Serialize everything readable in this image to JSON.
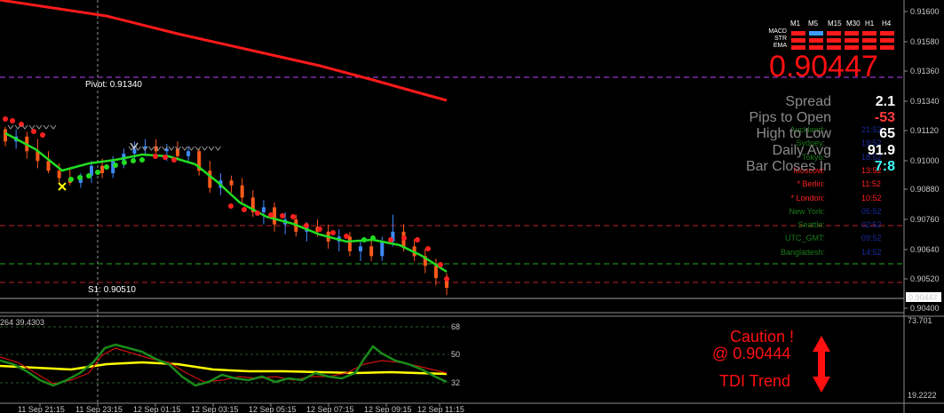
{
  "chart_data": [
    {
      "type": "candlestick",
      "title": "",
      "y_axis_ticks": [
        "0.91600",
        "0.91580",
        "0.91360",
        "0.91340",
        "0.91120",
        "0.91000",
        "0.90880",
        "0.90760",
        "0.90640",
        "0.90520",
        "0.90400"
      ],
      "current_price_tag": "0.90447",
      "x_axis_ticks": [
        "11 Sep 21:15",
        "11 Sep 23:15",
        "12 Sep 01:15",
        "12 Sep 03:15",
        "12 Sep 05:15",
        "12 Sep 07:15",
        "12 Sep 09:15",
        "12 Sep 11:15"
      ],
      "pivot_label": "Pivot: 0.91340",
      "s1_label": "S1: 0.90510",
      "ylim": [
        0.9039,
        0.9165
      ],
      "candles": [
        [
          0.9112,
          0.9113,
          0.9105,
          0.9107
        ],
        [
          0.9107,
          0.9112,
          0.9104,
          0.9109
        ],
        [
          0.9109,
          0.9111,
          0.91,
          0.9103
        ],
        [
          0.9103,
          0.9108,
          0.9096,
          0.9099
        ],
        [
          0.9099,
          0.9103,
          0.9094,
          0.9095
        ],
        [
          0.9095,
          0.9098,
          0.909,
          0.9092
        ],
        [
          0.9092,
          0.9096,
          0.9089,
          0.909
        ],
        [
          0.909,
          0.9094,
          0.9088,
          0.9093
        ],
        [
          0.9093,
          0.9099,
          0.909,
          0.9097
        ],
        [
          0.9097,
          0.91,
          0.9092,
          0.9094
        ],
        [
          0.9094,
          0.9101,
          0.9092,
          0.9099
        ],
        [
          0.9099,
          0.9104,
          0.9096,
          0.9102
        ],
        [
          0.9102,
          0.9107,
          0.91,
          0.9104
        ],
        [
          0.9104,
          0.9108,
          0.9101,
          0.9105
        ],
        [
          0.9105,
          0.9108,
          0.91,
          0.9103
        ],
        [
          0.9103,
          0.9106,
          0.9099,
          0.9104
        ],
        [
          0.9104,
          0.9107,
          0.91,
          0.9101
        ],
        [
          0.9101,
          0.9105,
          0.9099,
          0.9103
        ],
        [
          0.9103,
          0.9104,
          0.9093,
          0.9095
        ],
        [
          0.9095,
          0.9099,
          0.9086,
          0.9088
        ],
        [
          0.9088,
          0.9094,
          0.9085,
          0.9091
        ],
        [
          0.9091,
          0.9093,
          0.9086,
          0.9089
        ],
        [
          0.9089,
          0.9092,
          0.9082,
          0.9084
        ],
        [
          0.9084,
          0.9087,
          0.9076,
          0.9078
        ],
        [
          0.9078,
          0.9083,
          0.9073,
          0.908
        ],
        [
          0.908,
          0.9082,
          0.907,
          0.9073
        ],
        [
          0.9073,
          0.9078,
          0.9069,
          0.9075
        ],
        [
          0.9075,
          0.9077,
          0.9068,
          0.907
        ],
        [
          0.907,
          0.9074,
          0.9066,
          0.9072
        ],
        [
          0.9072,
          0.9075,
          0.9068,
          0.907
        ],
        [
          0.907,
          0.9073,
          0.9063,
          0.9066
        ],
        [
          0.9066,
          0.9071,
          0.9062,
          0.9068
        ],
        [
          0.9068,
          0.907,
          0.906,
          0.9062
        ],
        [
          0.9062,
          0.9066,
          0.9058,
          0.9064
        ],
        [
          0.9064,
          0.9067,
          0.9058,
          0.906
        ],
        [
          0.906,
          0.9068,
          0.9058,
          0.9066
        ],
        [
          0.9066,
          0.9077,
          0.9064,
          0.907
        ],
        [
          0.907,
          0.9073,
          0.9062,
          0.9064
        ],
        [
          0.9064,
          0.9067,
          0.9058,
          0.906
        ],
        [
          0.906,
          0.9063,
          0.9053,
          0.9056
        ],
        [
          0.9056,
          0.9059,
          0.9048,
          0.9051
        ],
        [
          0.9051,
          0.9053,
          0.9044,
          0.9047
        ]
      ]
    },
    {
      "type": "line",
      "title": "",
      "header_text": "264 39.4303",
      "y_axis_ticks": [
        "73.701",
        "19.2222"
      ],
      "level_labels": [
        "68",
        "50",
        "32"
      ],
      "x_axis_ticks": [
        "11 Sep 21:15",
        "11 Sep 23:15",
        "12 Sep 01:15",
        "12 Sep 03:15",
        "12 Sep 05:15",
        "12 Sep 07:15",
        "12 Sep 09:15",
        "12 Sep 11:15"
      ],
      "ylim": [
        19.2222,
        73.701
      ]
    }
  ],
  "panel": {
    "timeframes": [
      "M1",
      "M5",
      "M15",
      "M30",
      "H1",
      "H4"
    ],
    "indicator_labels": [
      "MACD",
      "STR",
      "EMA"
    ],
    "price": "0.90447",
    "stats": [
      {
        "label": "Spread",
        "value": "2.1",
        "color": "#ffffff"
      },
      {
        "label": "Pips to Open",
        "value": "-53",
        "color": "#ff3b3b"
      },
      {
        "label": "High to Low",
        "value": "65",
        "color": "#ffffff"
      },
      {
        "label": "Daily Avg",
        "value": "91.9",
        "color": "#ffffff"
      },
      {
        "label": "Bar Closes In",
        "value": "7:8",
        "color": "#40ffff"
      }
    ],
    "cities": [
      {
        "name": "Auckland:",
        "time": "21:52",
        "color": "#1a7a1a",
        "tcolor": "#1a2aa0"
      },
      {
        "name": "Sydney:",
        "time": "19:52",
        "color": "#1a7a1a",
        "tcolor": "#1a2aa0"
      },
      {
        "name": "Tokyo:",
        "time": "18:52",
        "color": "#1a7a1a",
        "tcolor": "#1a2aa0"
      },
      {
        "name": "Moscow:",
        "time": "13:52",
        "color": "#ff2020",
        "tcolor": "#ff2020"
      },
      {
        "name": "* Berlin:",
        "time": "11:52",
        "color": "#ff2020",
        "tcolor": "#ff2020"
      },
      {
        "name": "* London:",
        "time": "10:52",
        "color": "#ff2020",
        "tcolor": "#ff2020"
      },
      {
        "name": "New York:",
        "time": "05:52",
        "color": "#1a7a1a",
        "tcolor": "#1a2aa0"
      },
      {
        "name": "Seattle:",
        "time": "02:52",
        "color": "#1a7a1a",
        "tcolor": "#1a2aa0"
      },
      {
        "name": "UTC_GMT:",
        "time": "09:52",
        "color": "#1a7a1a",
        "tcolor": "#1a2aa0"
      },
      {
        "name": "Bangladesh:",
        "time": "14:52",
        "color": "#1a7a1a",
        "tcolor": "#1a2aa0"
      }
    ],
    "caution_1": "Caution !",
    "caution_2": "@ 0.90444",
    "trend_label": "TDI Trend",
    "colors": {
      "bull": "#3d8bff",
      "bear": "#ff5a1a",
      "ma": "#ff1a1a",
      "green": "#22dd22",
      "yellow": "#ffff00",
      "accent": "#ff1010"
    }
  }
}
